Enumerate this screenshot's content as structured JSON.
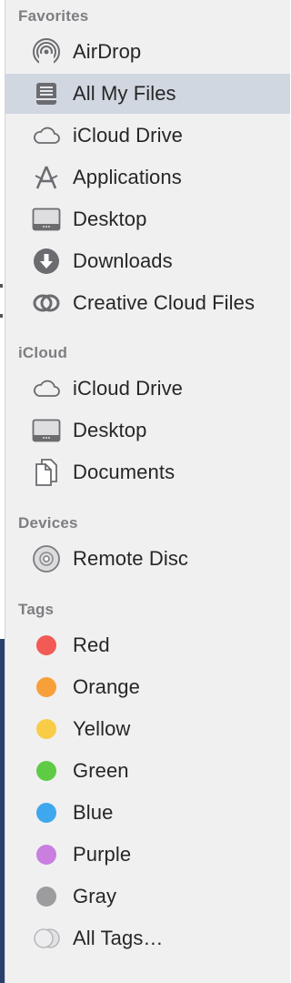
{
  "sections": {
    "favorites": {
      "header": "Favorites",
      "items": [
        {
          "label": "AirDrop",
          "icon": "airdrop-icon"
        },
        {
          "label": "All My Files",
          "icon": "all-my-files-icon",
          "selected": true
        },
        {
          "label": "iCloud Drive",
          "icon": "cloud-icon"
        },
        {
          "label": "Applications",
          "icon": "applications-icon"
        },
        {
          "label": "Desktop",
          "icon": "desktop-icon"
        },
        {
          "label": "Downloads",
          "icon": "downloads-icon"
        },
        {
          "label": "Creative Cloud Files",
          "icon": "creative-cloud-icon"
        }
      ]
    },
    "icloud": {
      "header": "iCloud",
      "items": [
        {
          "label": "iCloud Drive",
          "icon": "cloud-icon"
        },
        {
          "label": "Desktop",
          "icon": "desktop-icon"
        },
        {
          "label": "Documents",
          "icon": "documents-icon"
        }
      ]
    },
    "devices": {
      "header": "Devices",
      "items": [
        {
          "label": "Remote Disc",
          "icon": "remote-disc-icon"
        }
      ]
    },
    "tags": {
      "header": "Tags",
      "items": [
        {
          "label": "Red",
          "color": "#f25a55"
        },
        {
          "label": "Orange",
          "color": "#f7a03a"
        },
        {
          "label": "Yellow",
          "color": "#f9cc47"
        },
        {
          "label": "Green",
          "color": "#5fcb45"
        },
        {
          "label": "Blue",
          "color": "#3fa7ee"
        },
        {
          "label": "Purple",
          "color": "#c97ee0"
        },
        {
          "label": "Gray",
          "color": "#9c9c9e"
        },
        {
          "label": "All Tags…",
          "icon": "all-tags-icon"
        }
      ]
    }
  }
}
